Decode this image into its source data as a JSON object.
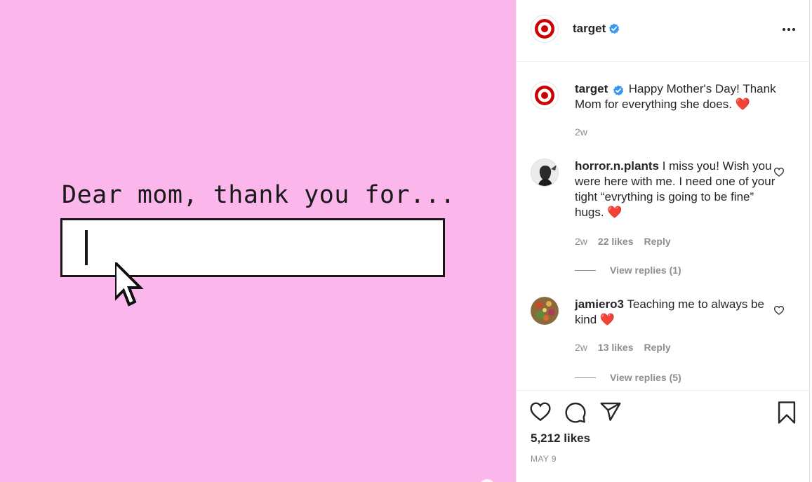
{
  "media": {
    "title": "Dear mom, thank you for...",
    "background": "#fbb6ec"
  },
  "header": {
    "username": "target",
    "verified": true,
    "more_icon": "more-horizontal-icon"
  },
  "caption": {
    "username": "target",
    "text": "Happy Mother's Day! Thank Mom for everything she does.",
    "emoji": "❤️",
    "time": "2w"
  },
  "comments": [
    {
      "username": "horror.n.plants",
      "text": "I miss you! Wish you were here with me. I need one of your tight “evrything is going to be fine” hugs.",
      "emoji": "❤️",
      "time": "2w",
      "likes": "22 likes",
      "reply": "Reply",
      "view_replies": "View replies (1)"
    },
    {
      "username": "jamiero3",
      "text": "Teaching me to always be kind",
      "emoji": "❤️",
      "time": "2w",
      "likes": "13 likes",
      "reply": "Reply",
      "view_replies": "View replies (5)"
    }
  ],
  "actions": {
    "like_icon": "heart-icon",
    "comment_icon": "comment-icon",
    "share_icon": "share-icon",
    "save_icon": "bookmark-icon"
  },
  "likes": "5,212 likes",
  "date": "MAY 9",
  "colors": {
    "brand_red": "#cc0000",
    "verified_blue": "#3897f0",
    "heart_red": "#ed2a24",
    "muted": "#8e8e8e"
  }
}
